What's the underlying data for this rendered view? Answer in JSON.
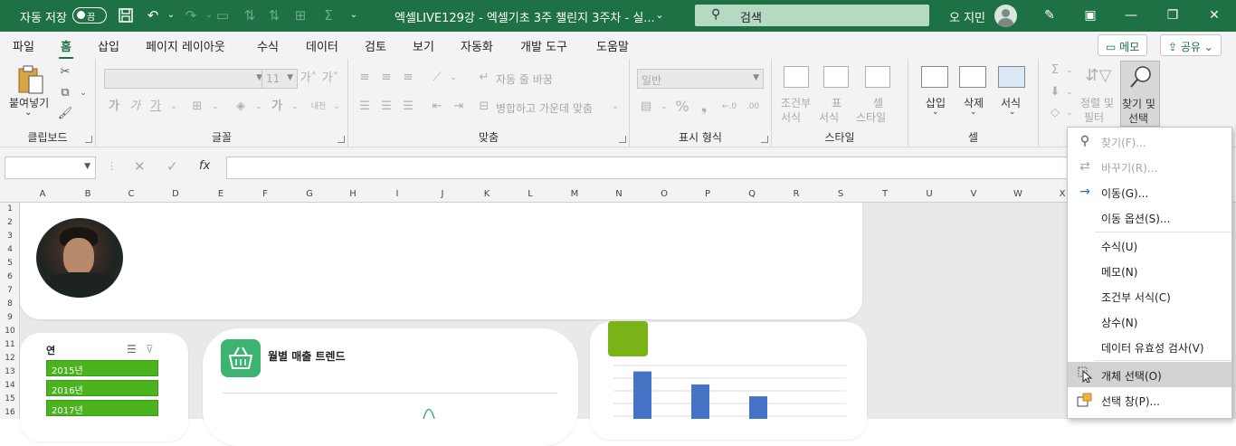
{
  "titlebar": {
    "autosave_label": "자동 저장",
    "autosave_state": "끔",
    "doc_title": "엑셀LIVE129강 - 엑셀기초 3주 챌린지 3주차 - 실...",
    "search_placeholder": "검색",
    "user_name": "오 지민"
  },
  "tabs": [
    "파일",
    "홈",
    "삽입",
    "페이지 레이아웃",
    "수식",
    "데이터",
    "검토",
    "보기",
    "자동화",
    "개발 도구",
    "도움말"
  ],
  "active_tab": "홈",
  "memo_button": "메모",
  "share_button": "공유",
  "ribbon": {
    "clipboard": {
      "paste": "붙여넣기",
      "group": "클립보드"
    },
    "font": {
      "font_size": "11",
      "group": "글꼴"
    },
    "align": {
      "wrap": "자동 줄 바꿈",
      "merge": "병합하고 가운데 맞춤",
      "group": "맞춤"
    },
    "number": {
      "format": "일반",
      "group": "표시 형식"
    },
    "style": {
      "conditional_1": "조건부",
      "conditional_2": "서식",
      "table_1": "표",
      "table_2": "서식",
      "cell_1": "셀",
      "cell_2": "스타일",
      "group": "스타일"
    },
    "cells": {
      "insert": "삽입",
      "delete": "삭제",
      "format": "서식",
      "group": "셀"
    },
    "editing": {
      "sort_1": "정렬 및",
      "sort_2": "필터",
      "find_1": "찾기 및",
      "find_2": "선택"
    }
  },
  "formula_bar": {
    "name_box": "",
    "fx": "fx",
    "value": ""
  },
  "columns": [
    "A",
    "B",
    "C",
    "D",
    "E",
    "F",
    "G",
    "H",
    "I",
    "J",
    "K",
    "L",
    "M",
    "N",
    "O",
    "P",
    "Q",
    "R",
    "S",
    "T",
    "U",
    "V",
    "W",
    "X"
  ],
  "rows": [
    "1",
    "2",
    "3",
    "4",
    "5",
    "6",
    "7",
    "8",
    "9",
    "10",
    "11",
    "12",
    "13",
    "14",
    "15",
    "16"
  ],
  "slicer": {
    "title": "연",
    "items": [
      "2015년",
      "2016년",
      "2017년"
    ]
  },
  "chart_card": {
    "title": "월별 매출 트렌드"
  },
  "chart_data": {
    "type": "bar",
    "categories": [
      "",
      "",
      ""
    ],
    "values": [
      40,
      29,
      19
    ],
    "ylim": [
      0,
      45
    ],
    "color": "#4472c4",
    "grid": true
  },
  "find_menu": {
    "items": [
      {
        "label": "찾기(F)...",
        "icon": "search-icon",
        "enabled": false
      },
      {
        "label": "바꾸기(R)...",
        "icon": "replace-icon",
        "enabled": false
      },
      {
        "label": "이동(G)...",
        "icon": "arrow-right-icon",
        "enabled": true
      },
      {
        "label": "이동 옵션(S)...",
        "icon": "",
        "enabled": true
      },
      {
        "label": "수식(U)",
        "icon": "",
        "enabled": true
      },
      {
        "label": "메모(N)",
        "icon": "",
        "enabled": true
      },
      {
        "label": "조건부 서식(C)",
        "icon": "",
        "enabled": true
      },
      {
        "label": "상수(N)",
        "icon": "",
        "enabled": true
      },
      {
        "label": "데이터 유효성 검사(V)",
        "icon": "",
        "enabled": true
      },
      {
        "label": "개체 선택(O)",
        "icon": "cursor-icon",
        "enabled": true,
        "highlighted": true
      },
      {
        "label": "선택 창(P)...",
        "icon": "selection-pane-icon",
        "enabled": true
      }
    ]
  },
  "colors": {
    "brand": "#1e7145",
    "slicer": "#4ab31e",
    "bar": "#4472c4",
    "chart_icon_bg": "#3cb371",
    "card_icon_bg": "#7ab317"
  }
}
